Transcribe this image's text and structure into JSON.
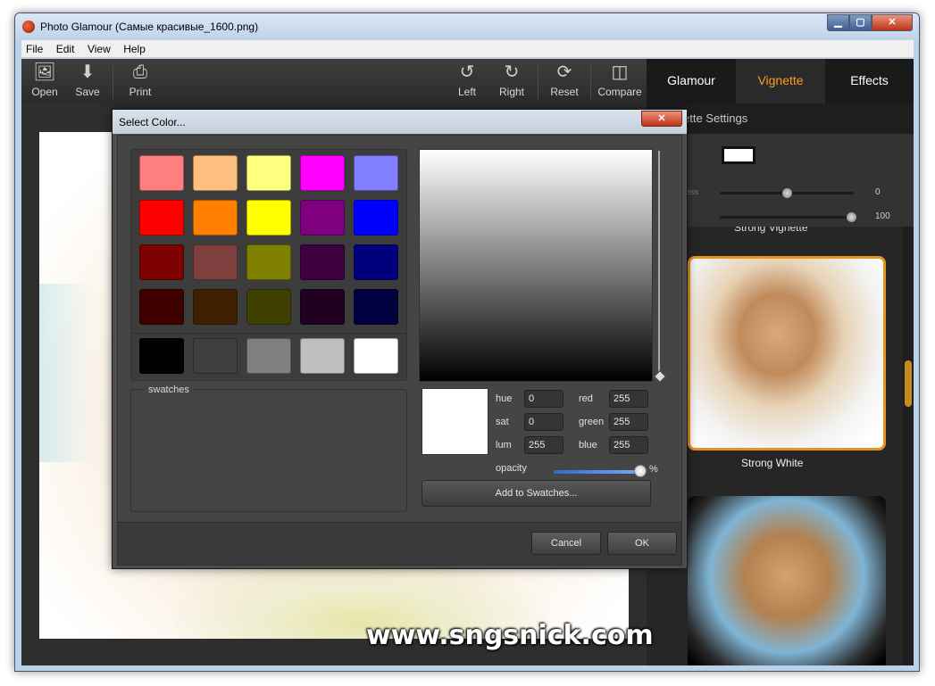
{
  "window": {
    "title": "Photo Glamour (Самые красивые_1600.png)",
    "controls": {
      "minimize": "▁",
      "maximize": "▢",
      "close": "✕"
    }
  },
  "menu": [
    "File",
    "Edit",
    "View",
    "Help"
  ],
  "toolbar": {
    "open": "Open",
    "save": "Save",
    "print": "Print",
    "left": "Left",
    "right": "Right",
    "reset": "Reset",
    "compare": "Compare"
  },
  "tabs": [
    {
      "label": "Glamour",
      "active": false
    },
    {
      "label": "Vignette",
      "active": true
    },
    {
      "label": "Effects",
      "active": false
    }
  ],
  "vignette_panel": {
    "header": "ette Settings",
    "color": "#ffffff",
    "slider1_label": "ess",
    "slider1_value": "0",
    "slider2_value": "100",
    "clipped_label": "Strong Vignette",
    "item_label": "Strong White"
  },
  "watermark": "www.sngsnick.com",
  "dialog": {
    "title": "Select Color...",
    "close": "✕",
    "swatches_label": "swatches",
    "palette": [
      [
        "#ff7f7f",
        "#ffbf7f",
        "#ffff7f",
        "#ff00ff",
        "#7f7fff"
      ],
      [
        "#ff0000",
        "#ff7f00",
        "#ffff00",
        "#7f007f",
        "#0000ff"
      ],
      [
        "#7f0000",
        "#7f3f3f",
        "#7f7f00",
        "#3f003f",
        "#00007f"
      ],
      [
        "#3f0000",
        "#3f1f00",
        "#3f3f00",
        "#1f001f",
        "#00003f"
      ],
      [
        "#000000",
        "#3f3f3f",
        "#7f7f7f",
        "#bfbfbf",
        "#ffffff"
      ]
    ],
    "fields": {
      "hue_label": "hue",
      "hue": "0",
      "sat_label": "sat",
      "sat": "0",
      "lum_label": "lum",
      "lum": "255",
      "red_label": "red",
      "red": "255",
      "green_label": "green",
      "green": "255",
      "blue_label": "blue",
      "blue": "255"
    },
    "opacity_label": "opacity",
    "opacity_unit": "%",
    "opacity_value": 1.0,
    "add_button": "Add to Swatches...",
    "cancel": "Cancel",
    "ok": "OK"
  }
}
